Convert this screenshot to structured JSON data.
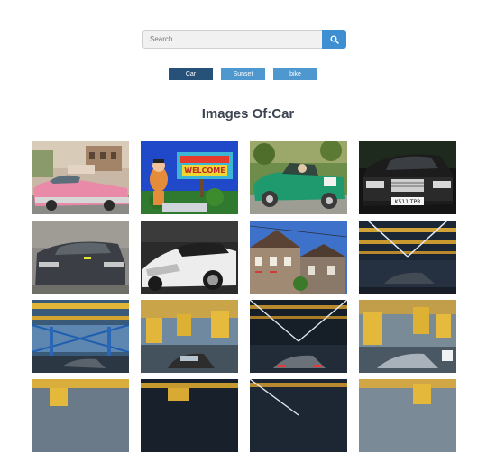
{
  "search": {
    "placeholder": "Search",
    "value": "",
    "button_icon": "search-icon"
  },
  "filters": [
    {
      "label": "Car",
      "active": true
    },
    {
      "label": "Sunset",
      "active": false
    },
    {
      "label": "bike",
      "active": false
    }
  ],
  "heading": "Images Of:Car",
  "colors": {
    "accent": "#3d8fd1",
    "chip": "#4e98cf",
    "chip_active": "#265178",
    "heading": "#3d4553"
  },
  "images": [
    {
      "subject": "pink classic car",
      "plate": ""
    },
    {
      "subject": "welcome sign",
      "sign_text": "WELCOME"
    },
    {
      "subject": "green vintage roadster"
    },
    {
      "subject": "black mercedes sedan",
      "plate": "K511 TPR"
    },
    {
      "subject": "blurred dark sedan"
    },
    {
      "subject": "white supercar"
    },
    {
      "subject": "old houses street"
    },
    {
      "subject": "garage interior"
    },
    {
      "subject": "industrial hangar"
    },
    {
      "subject": "yellow pipes garage car"
    },
    {
      "subject": "garage car lights"
    },
    {
      "subject": "yellow pipes garage silver car"
    },
    {
      "subject": "garage"
    },
    {
      "subject": "garage"
    },
    {
      "subject": "garage"
    },
    {
      "subject": "garage"
    }
  ]
}
